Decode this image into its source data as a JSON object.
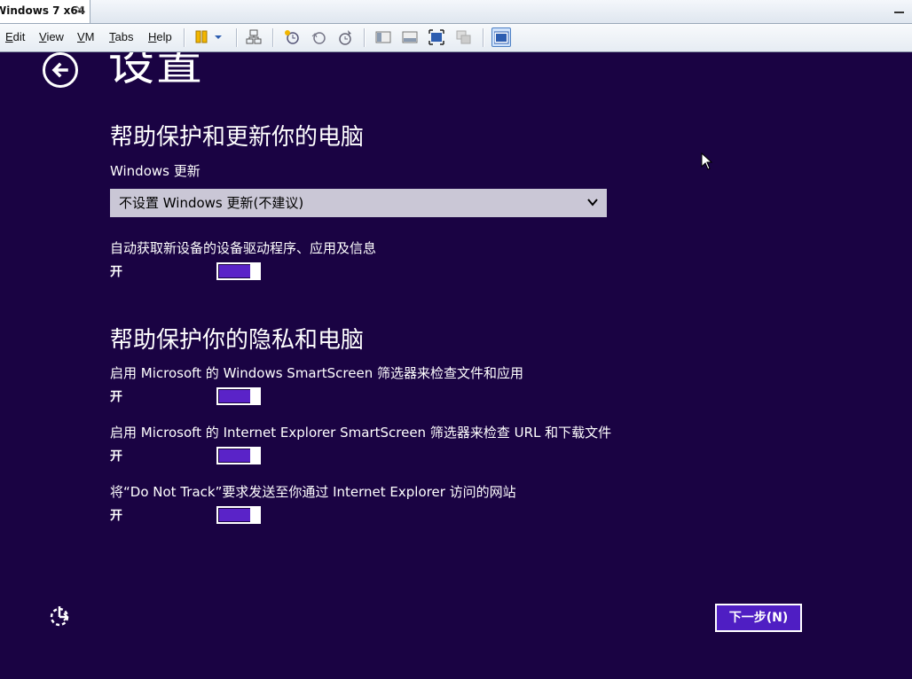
{
  "host": {
    "tab_title": "Windows 7 x64",
    "tab_close": "×",
    "menu": [
      "Edit",
      "View",
      "VM",
      "Tabs",
      "Help"
    ],
    "menu_mnemonic": [
      "E",
      "V",
      "V",
      "T",
      "H"
    ]
  },
  "oobe": {
    "page_title": "设置",
    "section1": {
      "heading": "帮助保护和更新你的电脑",
      "update_label": "Windows 更新",
      "update_select_value": "不设置 Windows 更新(不建议)",
      "driver_label": "自动获取新设备的设备驱动程序、应用及信息",
      "driver_state": "开"
    },
    "section2": {
      "heading": "帮助保护你的隐私和电脑",
      "items": [
        {
          "label": "启用 Microsoft 的 Windows SmartScreen 筛选器来检查文件和应用",
          "state": "开"
        },
        {
          "label": "启用 Microsoft 的 Internet Explorer SmartScreen 筛选器来检查 URL 和下载文件",
          "state": "开"
        },
        {
          "label": "将“Do Not Track”要求发送至你通过 Internet Explorer 访问的网站",
          "state": "开"
        }
      ]
    },
    "next_button": "下一步(N)",
    "colors": {
      "background": "#1a0343",
      "toggle_fill": "#5a23c8",
      "button": "#4f1ec3",
      "select_bg": "#cac7d6"
    }
  }
}
